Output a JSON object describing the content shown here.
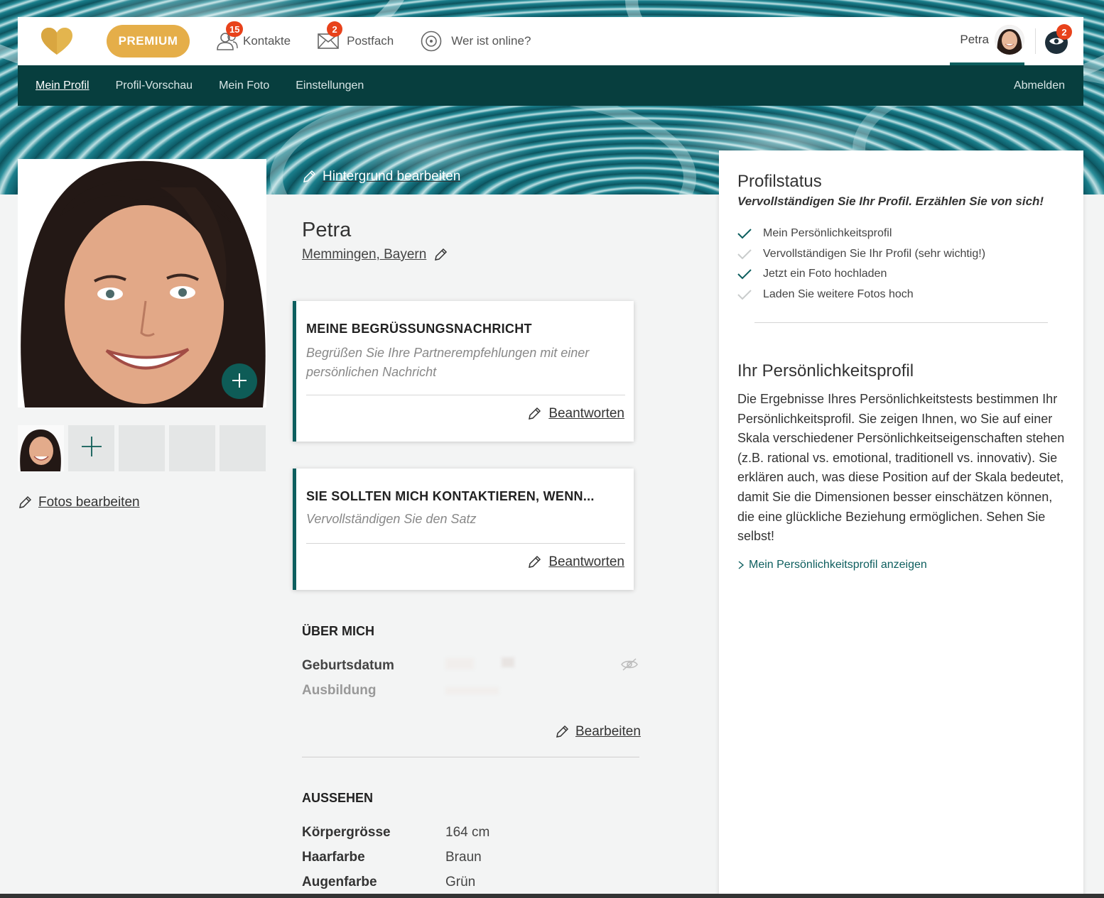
{
  "topbar": {
    "premium_label": "PREMIUM",
    "contacts_label": "Kontakte",
    "contacts_badge": "15",
    "inbox_label": "Postfach",
    "inbox_badge": "2",
    "online_label": "Wer ist online?",
    "user_name": "Petra",
    "visitors_badge": "2"
  },
  "subnav": {
    "items": [
      "Mein Profil",
      "Profil-Vorschau",
      "Mein Foto",
      "Einstellungen"
    ],
    "logout": "Abmelden"
  },
  "left": {
    "edit_photos": "Fotos bearbeiten"
  },
  "profile": {
    "edit_background": "Hintergrund bearbeiten",
    "name": "Petra",
    "location": "Memmingen, Bayern"
  },
  "cards": [
    {
      "title": "MEINE BEGRÜSSUNGSNACHRICHT",
      "hint": "Begrüßen Sie Ihre Partnerempfehlungen mit einer persönlichen Nachricht",
      "action": "Beantworten"
    },
    {
      "title": "SIE SOLLTEN MICH KONTAKTIEREN, WENN...",
      "hint": "Vervollständigen Sie den Satz",
      "action": "Beantworten"
    }
  ],
  "about": {
    "title": "ÜBER MICH",
    "birth_label": "Geburtsdatum",
    "education_label": "Ausbildung",
    "edit": "Bearbeiten"
  },
  "looks": {
    "title": "AUSSEHEN",
    "rows": [
      {
        "label": "Körpergrösse",
        "value": "164 cm"
      },
      {
        "label": "Haarfarbe",
        "value": "Braun"
      },
      {
        "label": "Augenfarbe",
        "value": "Grün"
      }
    ]
  },
  "status": {
    "title": "Profilstatus",
    "subtitle": "Vervollständigen Sie Ihr Profil. Erzählen Sie von sich!",
    "items": [
      {
        "label": "Mein Persönlichkeitsprofil",
        "done": true
      },
      {
        "label": "Vervollständigen Sie Ihr Profil (sehr wichtig!)",
        "done": false
      },
      {
        "label": "Jetzt ein Foto hochladen",
        "done": true
      },
      {
        "label": "Laden Sie weitere Fotos hoch",
        "done": false
      }
    ]
  },
  "personality": {
    "title": "Ihr Persönlichkeitsprofil",
    "text": "Die Ergebnisse Ihres Persönlichkeitstests bestimmen Ihr Persönlichkeitsprofil. Sie zeigen Ihnen, wo Sie auf einer Skala verschiedener Persönlichkeitseigenschaften stehen (z.B. rational vs. emotional, traditionell vs. innovativ). Sie erklären auch, was diese Position auf der Skala bedeutet, damit Sie die Dimensionen besser einschätzen können, die eine glückliche Beziehung ermöglichen. Sehen Sie selbst!",
    "link": "Mein Persönlichkeitsprofil anzeigen"
  },
  "colors": {
    "brand_dark": "#073e3e",
    "accent": "#0d5e5e",
    "premium": "#e5ae49",
    "badge": "#e8421b"
  }
}
